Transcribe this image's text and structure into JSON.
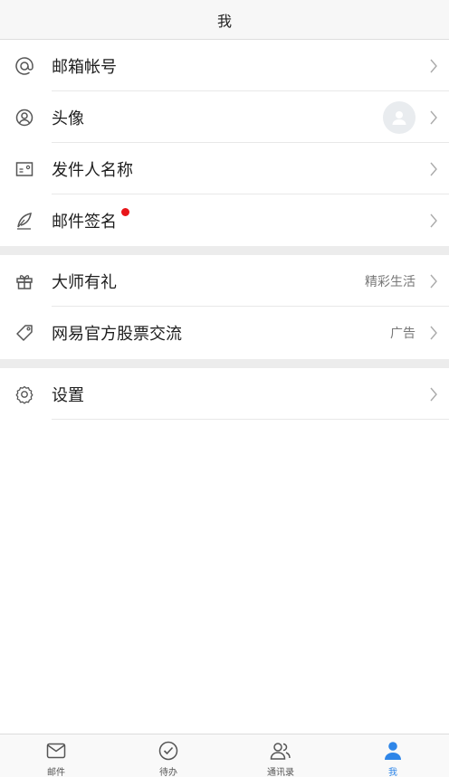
{
  "header": {
    "title": "我"
  },
  "group1": [
    {
      "label": "邮箱帐号",
      "icon": "at-icon"
    },
    {
      "label": "头像",
      "icon": "avatar-circle-icon"
    },
    {
      "label": "发件人名称",
      "icon": "name-card-icon"
    },
    {
      "label": "邮件签名",
      "icon": "pen-nib-icon",
      "badge": "red-dot"
    }
  ],
  "group2": [
    {
      "label": "大师有礼",
      "icon": "gift-icon",
      "extra": "精彩生活"
    },
    {
      "label": "网易官方股票交流",
      "icon": "tag-icon",
      "extra": "广告"
    }
  ],
  "group3": [
    {
      "label": "设置",
      "icon": "gear-icon"
    }
  ],
  "tabbar": [
    {
      "label": "邮件",
      "icon": "mail-icon",
      "active": false
    },
    {
      "label": "待办",
      "icon": "check-circle-icon",
      "active": false
    },
    {
      "label": "通讯录",
      "icon": "contacts-icon",
      "active": false
    },
    {
      "label": "我",
      "icon": "person-icon",
      "active": true
    }
  ],
  "colors": {
    "accent": "#2f86e8",
    "badge": "#e8161a",
    "gap": "#ececec"
  }
}
